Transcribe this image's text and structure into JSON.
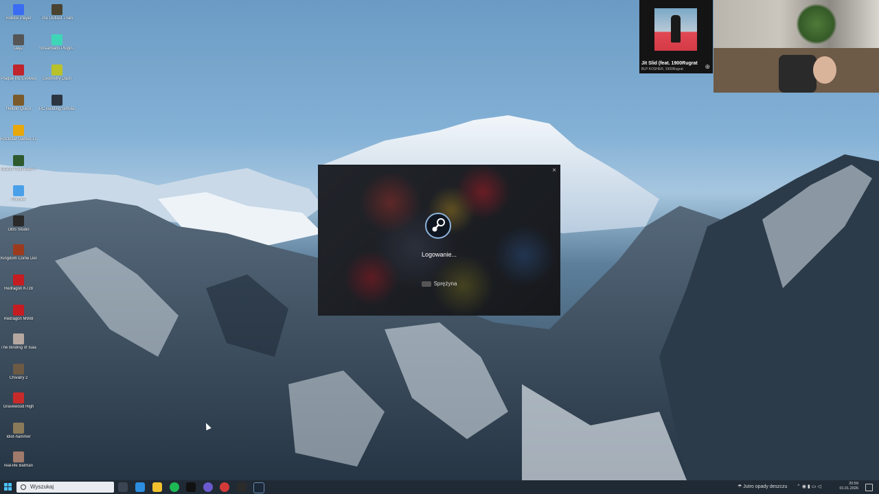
{
  "desktop": {
    "icons": [
      {
        "label": "Roblox Player",
        "color": "#3a6cf2"
      },
      {
        "label": "The Outlast Trials",
        "color": "#4a4330"
      },
      {
        "label": "DayZ",
        "color": "#555555"
      },
      {
        "label": "Streamlabs Plugin...",
        "color": "#3fd6b8"
      },
      {
        "label": "Plague Inc Evolved",
        "color": "#c0242c"
      },
      {
        "label": "Geometry Dash",
        "color": "#b9c22a"
      },
      {
        "label": "Hellion Quest",
        "color": "#7a5a2a"
      },
      {
        "label": "PC Building Simulator",
        "color": "#2c3540"
      },
      {
        "label": "Rockstar Games Launcher",
        "color": "#e8a80c"
      },
      {
        "label": "Grand Theft Auto V",
        "color": "#2e5a2e"
      },
      {
        "label": "Fortnite",
        "color": "#4aa0e8"
      },
      {
        "label": "OBS Studio",
        "color": "#2a2a2a"
      },
      {
        "label": "Kingdom Come Deliverance",
        "color": "#9c3a1e"
      },
      {
        "label": "Redragon K728",
        "color": "#c51c22"
      },
      {
        "label": "Redragon M908",
        "color": "#c51c22"
      },
      {
        "label": "The Binding of Isaac Rebirth",
        "color": "#b5a8a0"
      },
      {
        "label": "Chivalry 2",
        "color": "#6c5a44"
      },
      {
        "label": "Gravewood High",
        "color": "#c82a2a"
      },
      {
        "label": "Idiot-hammer",
        "color": "#8a7a5a"
      },
      {
        "label": "real-life Batman",
        "color": "#a07a6a"
      }
    ]
  },
  "now_playing": {
    "song": "Jit Slid (feat. 1900Rugrat",
    "artist": "BLP KOSHER, 1900Rugrat",
    "plus_icon": "plus-circle-icon"
  },
  "steam_dialog": {
    "status": "Logowanie...",
    "user": "Sprężyna",
    "close": "×",
    "logo_icon": "steam-logo-icon"
  },
  "taskbar": {
    "search_placeholder": "Wyszukaj",
    "weather_text": "Jutro opady deszczu",
    "time": "20:59",
    "date": "01.01.2026",
    "apps": [
      {
        "name": "task-view-icon",
        "color": "#3b4452"
      },
      {
        "name": "edge-icon",
        "color": "#2d8ee0"
      },
      {
        "name": "file-explorer-icon",
        "color": "#f2c12e"
      },
      {
        "name": "spotify-icon",
        "color": "#1db954"
      },
      {
        "name": "tiktok-icon",
        "color": "#111111"
      },
      {
        "name": "chrome-icon",
        "color": "#6a5acd"
      },
      {
        "name": "app-red-icon",
        "color": "#d23a3a"
      },
      {
        "name": "epic-games-icon",
        "color": "#2b2b2b"
      },
      {
        "name": "steam-icon",
        "color": "#1b2838"
      }
    ]
  }
}
